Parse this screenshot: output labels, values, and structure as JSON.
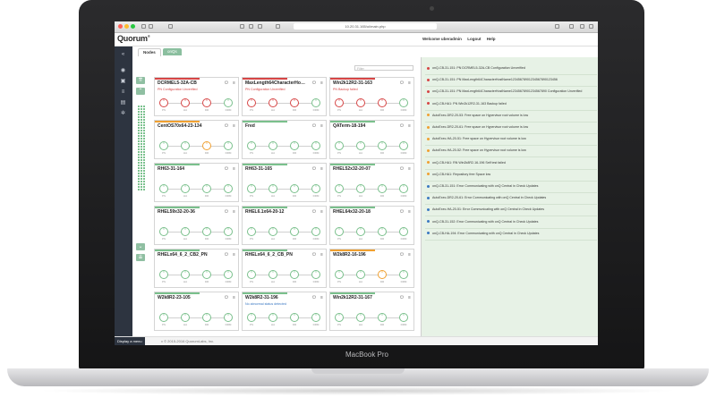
{
  "device": {
    "label": "MacBook Pro"
  },
  "browser": {
    "url": "10.20.31.165/ui/main.php"
  },
  "app": {
    "logo": "Quorum",
    "logo_mark": "®"
  },
  "header": {
    "welcome": "Welcome uberadmin",
    "logout": "Logout",
    "help": "Help"
  },
  "tabs": [
    {
      "label": "Nodes",
      "active": true
    },
    {
      "label": "onQs",
      "active": false
    }
  ],
  "filter": {
    "placeholder": "Filter"
  },
  "node_labels": {
    "ps": "PS",
    "ha": "HA",
    "dr": "DR",
    "drm": "DRM",
    "test": "Test"
  },
  "nodes": [
    {
      "name": "DCRMEL5-32A-CB",
      "status": "PN Configuration Unverified",
      "status_color": "#d64545",
      "accent": "#d64545"
    },
    {
      "name": "MaxLength64CharacterHo…",
      "status": "PN Configuration Unverified",
      "status_color": "#d64545",
      "accent": "#d64545"
    },
    {
      "name": "Win2k12R2-31-163",
      "status": "PN Backup failed",
      "status_color": "#d64545",
      "accent": "#d64545"
    },
    {
      "name": "CentOS70x64-23-134",
      "status": "",
      "status_color": "",
      "accent": "#f0a030"
    },
    {
      "name": "Fred",
      "status": "",
      "status_color": "",
      "accent": "#7ac08c"
    },
    {
      "name": "QATerm-18-194",
      "status": "",
      "status_color": "",
      "accent": "#7ac08c"
    },
    {
      "name": "RH63-31-164",
      "status": "",
      "status_color": "",
      "accent": "#7ac08c"
    },
    {
      "name": "RH63-31-165",
      "status": "",
      "status_color": "",
      "accent": "#7ac08c"
    },
    {
      "name": "RHEL52x32-20-07",
      "status": "",
      "status_color": "",
      "accent": "#7ac08c"
    },
    {
      "name": "RHEL59x32-20-36",
      "status": "",
      "status_color": "",
      "accent": "#7ac08c"
    },
    {
      "name": "RHEL6.1x64-20-12",
      "status": "",
      "status_color": "",
      "accent": "#7ac08c"
    },
    {
      "name": "RHEL64x32-20-18",
      "status": "",
      "status_color": "",
      "accent": "#7ac08c"
    },
    {
      "name": "RHELx64_6_2_CB2_PN",
      "status": "",
      "status_color": "",
      "accent": "#7ac08c"
    },
    {
      "name": "RHELx64_6_2_CB_PN",
      "status": "",
      "status_color": "",
      "accent": "#7ac08c"
    },
    {
      "name": "W2k8R2-16-196",
      "status": "",
      "status_color": "",
      "accent": "#f0a030"
    },
    {
      "name": "W2k8R2-23-105",
      "status": "",
      "status_color": "",
      "accent": "#7ac08c"
    },
    {
      "name": "W2k8R2-31-196",
      "status": "No abnormal status detected",
      "status_color": "#3a78c2",
      "accent": "#7ac08c"
    },
    {
      "name": "Win2k12R2-31-167",
      "status": "",
      "status_color": "",
      "accent": "#7ac08c"
    }
  ],
  "alerts": [
    {
      "text": "onQ-CB-31-151: PN DCRMEL5-32A-CB Configuration Unverified",
      "color": "#d64545"
    },
    {
      "text": "onQ-CB-31-151: PN MaxLength64CharacterHostName12345678901234567890123456",
      "color": "#d64545"
    },
    {
      "text": "onQ-CB-31-151: PN MaxLength64CharacterHostName12345678901234567890 Configuration Unverified",
      "color": "#d64545"
    },
    {
      "text": "onQ-CB-HA1: PN Win2k12R2-31-163 Backup failed",
      "color": "#d64545"
    },
    {
      "text": "AutoExec-DR2-20-53: Free space on Hypervisor root volume is low",
      "color": "#f0a030"
    },
    {
      "text": "AutoExec-DR2-20-61: Free space on Hypervisor root volume is low",
      "color": "#f0a030"
    },
    {
      "text": "AutoExec-HA-20-51: Free space on Hypervisor root volume is low",
      "color": "#f0a030"
    },
    {
      "text": "AutoExec-HA-20-52: Free space on Hypervisor root volume is low",
      "color": "#f0a030"
    },
    {
      "text": "onQ-CB-HA1: RN Win2k8R2-16-196 Self test failed",
      "color": "#f0a030"
    },
    {
      "text": "onQ-CB-HA1: Repository free Space low",
      "color": "#f0a030"
    },
    {
      "text": "onQ-CB-31-151: Error Communicating with onQ Central in Check Updates",
      "color": "#3a78c2"
    },
    {
      "text": "AutoExec-DR2-20-61: Error Communicating with onQ Central in Check Updates",
      "color": "#3a78c2"
    },
    {
      "text": "AutoExec-HA-20-51: Error Communicating with onQ Central in Check Updates",
      "color": "#3a78c2"
    },
    {
      "text": "onQ-CB-31-152: Error Communicating with onQ Central in Check Updates",
      "color": "#3a78c2"
    },
    {
      "text": "onQ-CB-HA-194: Error Communicating with onQ Central in Check Updates",
      "color": "#3a78c2"
    }
  ],
  "footer": {
    "menu": "Display a menu",
    "copyright": "v © 2015-2016 QuorumLabs, Inc."
  },
  "colors": {
    "green": "#7ac08c",
    "red": "#d64545",
    "orange": "#f0a030",
    "blue": "#3a78c2",
    "nav": "#2d3440"
  }
}
